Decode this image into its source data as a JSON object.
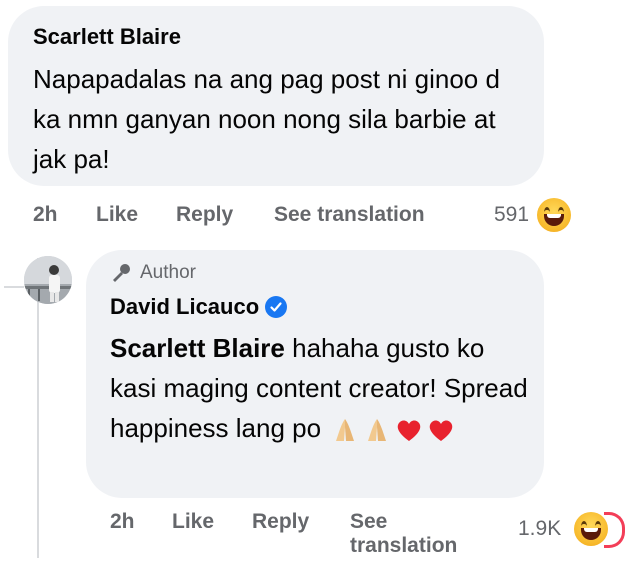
{
  "comment1": {
    "author": "Scarlett Blaire",
    "text": "Napapadalas na ang pag post ni ginoo d ka nmn ganyan noon nong sila barbie at jak pa!",
    "meta": {
      "time": "2h",
      "like": "Like",
      "reply": "Reply",
      "translation": "See translation"
    },
    "reaction_count": "591"
  },
  "reply1": {
    "badge": "Author",
    "author": "David Licauco",
    "mention": "Scarlett Blaire",
    "text": "hahaha gusto ko kasi maging content creator! Spread happiness lang po",
    "meta": {
      "time": "2h",
      "like": "Like",
      "reply": "Reply",
      "translation_line1": "See",
      "translation_line2": "translation"
    },
    "reaction_count": "1.9K"
  },
  "icons": {
    "verified": "verified-badge-icon",
    "author_badge": "microphone-icon",
    "reaction_primary": "haha-emoji",
    "reaction_secondary": "love-emoji",
    "inline_emojis": [
      "folded-hands",
      "folded-hands",
      "red-heart",
      "red-heart"
    ]
  },
  "colors": {
    "bubble": "#f0f2f5",
    "meta": "#65676b",
    "verified": "#1877f2",
    "heart": "#f33e58"
  }
}
